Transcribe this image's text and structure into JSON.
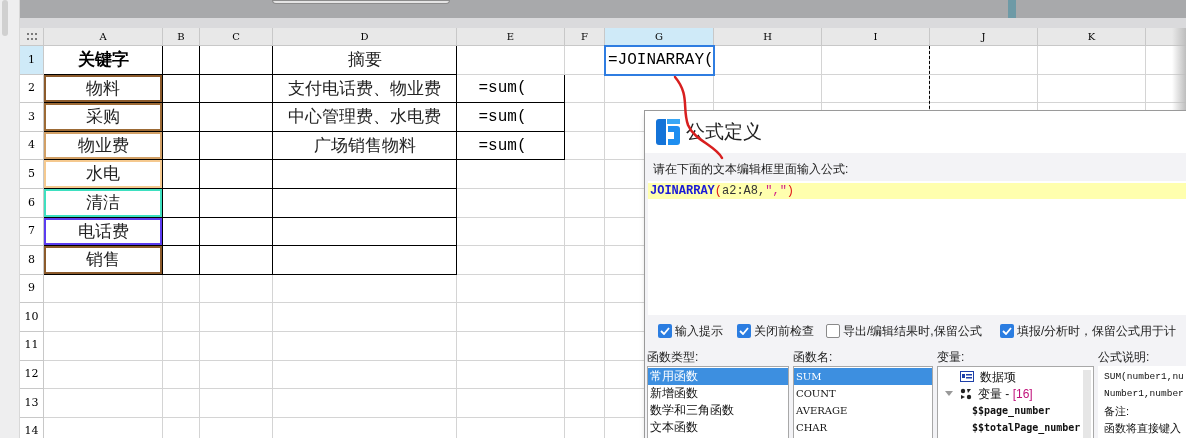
{
  "sheet": {
    "columns": [
      {
        "label": "A",
        "selected": false
      },
      {
        "label": "B",
        "selected": false
      },
      {
        "label": "C",
        "selected": false
      },
      {
        "label": "D",
        "selected": false
      },
      {
        "label": "E",
        "selected": false
      },
      {
        "label": "F",
        "selected": false
      },
      {
        "label": "G",
        "selected": true
      },
      {
        "label": "H",
        "selected": false
      },
      {
        "label": "I",
        "selected": false
      },
      {
        "label": "J",
        "selected": false
      },
      {
        "label": "K",
        "selected": false
      }
    ],
    "rows": [
      {
        "number": "1",
        "selected": true,
        "cells": [
          {
            "kind": "header",
            "text": "关键字",
            "boxed": true
          },
          {
            "kind": "empty",
            "boxed": true
          },
          {
            "kind": "empty",
            "boxed": true
          },
          {
            "kind": "text",
            "text": "摘要",
            "boxed": true
          },
          {
            "kind": "empty",
            "boxed": false
          },
          {
            "kind": "empty",
            "boxed": false
          },
          {
            "kind": "editing",
            "text": "=JOINARRAY("
          }
        ]
      },
      {
        "number": "2",
        "selected": false,
        "cells": [
          {
            "kind": "text",
            "text": "物料",
            "boxed": true,
            "color": "#8b5a2b"
          },
          {
            "kind": "empty",
            "boxed": true
          },
          {
            "kind": "empty",
            "boxed": true
          },
          {
            "kind": "text",
            "text": "支付电话费、物业费",
            "boxed": true
          },
          {
            "kind": "formula",
            "text": "=sum(",
            "boxed": true
          }
        ]
      },
      {
        "number": "3",
        "selected": false,
        "cells": [
          {
            "kind": "text",
            "text": "采购",
            "boxed": true,
            "color": "#9c6a35"
          },
          {
            "kind": "empty",
            "boxed": true
          },
          {
            "kind": "empty",
            "boxed": true
          },
          {
            "kind": "text",
            "text": "中心管理费、水电费",
            "boxed": true
          },
          {
            "kind": "formula",
            "text": "=sum(",
            "boxed": true
          }
        ]
      },
      {
        "number": "4",
        "selected": false,
        "cells": [
          {
            "kind": "text",
            "text": "物业费",
            "boxed": true,
            "color": "#d2a066"
          },
          {
            "kind": "empty",
            "boxed": true
          },
          {
            "kind": "empty",
            "boxed": true
          },
          {
            "kind": "text",
            "text": "广场销售物料",
            "boxed": true
          },
          {
            "kind": "formula",
            "text": "=sum(",
            "boxed": true
          }
        ]
      },
      {
        "number": "5",
        "selected": false,
        "cells": [
          {
            "kind": "text",
            "text": "水电",
            "boxed": true,
            "color": "#f5c98f"
          },
          {
            "kind": "empty",
            "boxed": true
          },
          {
            "kind": "empty",
            "boxed": true
          },
          {
            "kind": "empty",
            "boxed": true
          }
        ]
      },
      {
        "number": "6",
        "selected": false,
        "cells": [
          {
            "kind": "text",
            "text": "清洁",
            "boxed": true,
            "color": "#3ee0c0"
          },
          {
            "kind": "empty",
            "boxed": true
          },
          {
            "kind": "empty",
            "boxed": true
          },
          {
            "kind": "empty",
            "boxed": true
          }
        ]
      },
      {
        "number": "7",
        "selected": false,
        "cells": [
          {
            "kind": "text",
            "text": "电话费",
            "boxed": true,
            "color": "#5b3cf0"
          },
          {
            "kind": "empty",
            "boxed": true
          },
          {
            "kind": "empty",
            "boxed": true
          },
          {
            "kind": "empty",
            "boxed": true
          }
        ]
      },
      {
        "number": "8",
        "selected": false,
        "cells": [
          {
            "kind": "text",
            "text": "销售",
            "boxed": true,
            "color": "#8b5a2b"
          },
          {
            "kind": "empty",
            "boxed": true
          },
          {
            "kind": "empty",
            "boxed": true
          },
          {
            "kind": "empty",
            "boxed": true
          }
        ]
      },
      {
        "number": "9",
        "selected": false,
        "cells": []
      },
      {
        "number": "10",
        "selected": false,
        "cells": []
      },
      {
        "number": "11",
        "selected": false,
        "cells": []
      },
      {
        "number": "12",
        "selected": false,
        "cells": []
      },
      {
        "number": "13",
        "selected": false,
        "cells": []
      },
      {
        "number": "14",
        "selected": false,
        "cells": []
      }
    ]
  },
  "dialog": {
    "title": "公式定义",
    "prompt": "请在下面的文本编辑框里面输入公式:",
    "formula": [
      {
        "kind": "function",
        "text": "JOINARRAY"
      },
      {
        "kind": "paren",
        "text": "("
      },
      {
        "kind": "plain",
        "text": "a2:A8,"
      },
      {
        "kind": "string",
        "text": "\",\""
      },
      {
        "kind": "paren",
        "text": ")"
      }
    ],
    "options": [
      {
        "label": "输入提示",
        "checked": true
      },
      {
        "label": "关闭前检查",
        "checked": true
      },
      {
        "label": "导出/编辑结果时,保留公式",
        "checked": false
      },
      {
        "label": "填报/分析时，保留公式用于计",
        "checked": true
      }
    ],
    "function_types": {
      "label": "函数类型:",
      "items": [
        {
          "label": "常用函数",
          "selected": true
        },
        {
          "label": "新增函数",
          "selected": false
        },
        {
          "label": "数学和三角函数",
          "selected": false
        },
        {
          "label": "文本函数",
          "selected": false
        }
      ]
    },
    "function_names": {
      "label": "函数名:",
      "items": [
        {
          "label": "SUM",
          "selected": true
        },
        {
          "label": "COUNT",
          "selected": false
        },
        {
          "label": "AVERAGE",
          "selected": false
        },
        {
          "label": "CHAR",
          "selected": false
        }
      ]
    },
    "variables": {
      "label": "变量:",
      "items": [
        {
          "kind": "data",
          "label": "数据项"
        },
        {
          "kind": "group",
          "label": "变量 - ",
          "count": "[16]",
          "expanded": true,
          "children": [
            {
              "label": "$$page_number"
            },
            {
              "label": "$$totalPage_number"
            }
          ]
        }
      ]
    },
    "description": {
      "label": "公式说明:",
      "lines": [
        "SUM(number1,nu",
        "Number1,number",
        "备注:",
        "函数将直接键入"
      ]
    }
  }
}
